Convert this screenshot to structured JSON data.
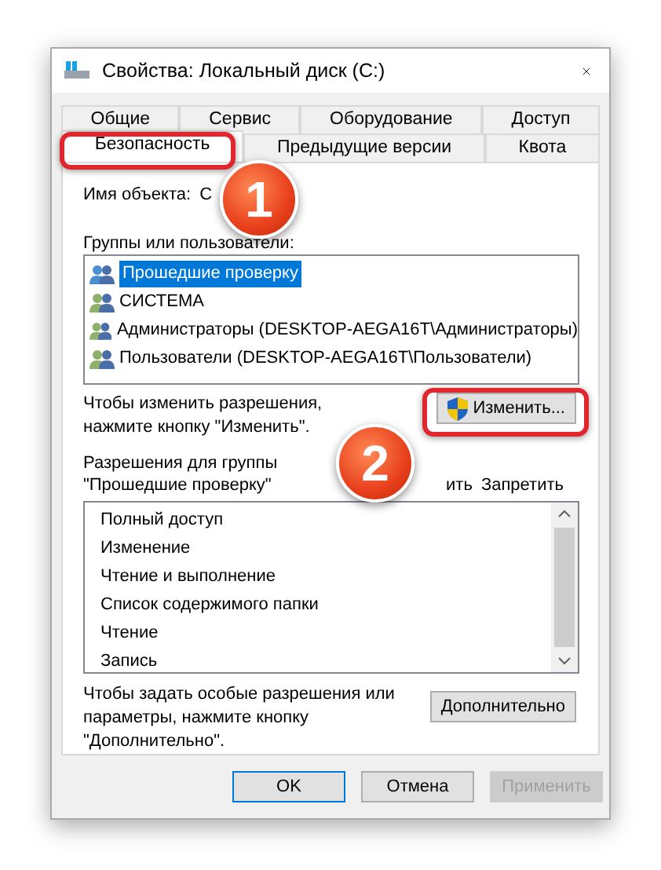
{
  "window": {
    "title": "Свойства: Локальный диск (C:)"
  },
  "tab_rows": [
    {
      "tabs": [
        {
          "label": "Общие",
          "selected": false
        },
        {
          "label": "Сервис",
          "selected": false
        },
        {
          "label": "Оборудование",
          "selected": false
        },
        {
          "label": "Доступ",
          "selected": false
        }
      ]
    },
    {
      "tabs": [
        {
          "label": "Безопасность",
          "selected": true
        },
        {
          "label": "Предыдущие версии",
          "selected": false
        },
        {
          "label": "Квота",
          "selected": false
        }
      ]
    }
  ],
  "object_name": {
    "label": "Имя объекта:",
    "value": "С"
  },
  "groups": {
    "label": "Группы или пользователи:",
    "items": [
      {
        "name": "Прошедшие проверку",
        "selected": true
      },
      {
        "name": "СИСТЕМА",
        "selected": false
      },
      {
        "name": "Администраторы (DESKTOP-AEGA16T\\Администраторы)",
        "selected": false
      },
      {
        "name": "Пользователи (DESKTOP-AEGA16T\\Пользователи)",
        "selected": false
      }
    ]
  },
  "change_hint": "Чтобы изменить разрешения, нажмите кнопку \"Изменить\".",
  "change_button": "Изменить...",
  "permissions": {
    "label": "Разрешения для группы \"Прошедшие проверку\"",
    "columns": [
      "ить",
      "Запретить"
    ],
    "items": [
      "Полный доступ",
      "Изменение",
      "Чтение и выполнение",
      "Список содержимого папки",
      "Чтение",
      "Запись"
    ]
  },
  "advanced_hint": "Чтобы задать особые разрешения или параметры, нажмите кнопку \"Дополнительно\".",
  "advanced_button": "Дополнительно",
  "buttons": [
    {
      "label": "OK",
      "kind": "default",
      "disabled": false
    },
    {
      "label": "Отмена",
      "kind": "normal",
      "disabled": false
    },
    {
      "label": "Применить",
      "kind": "normal",
      "disabled": true
    }
  ],
  "callouts": [
    {
      "number": "1"
    },
    {
      "number": "2"
    }
  ]
}
